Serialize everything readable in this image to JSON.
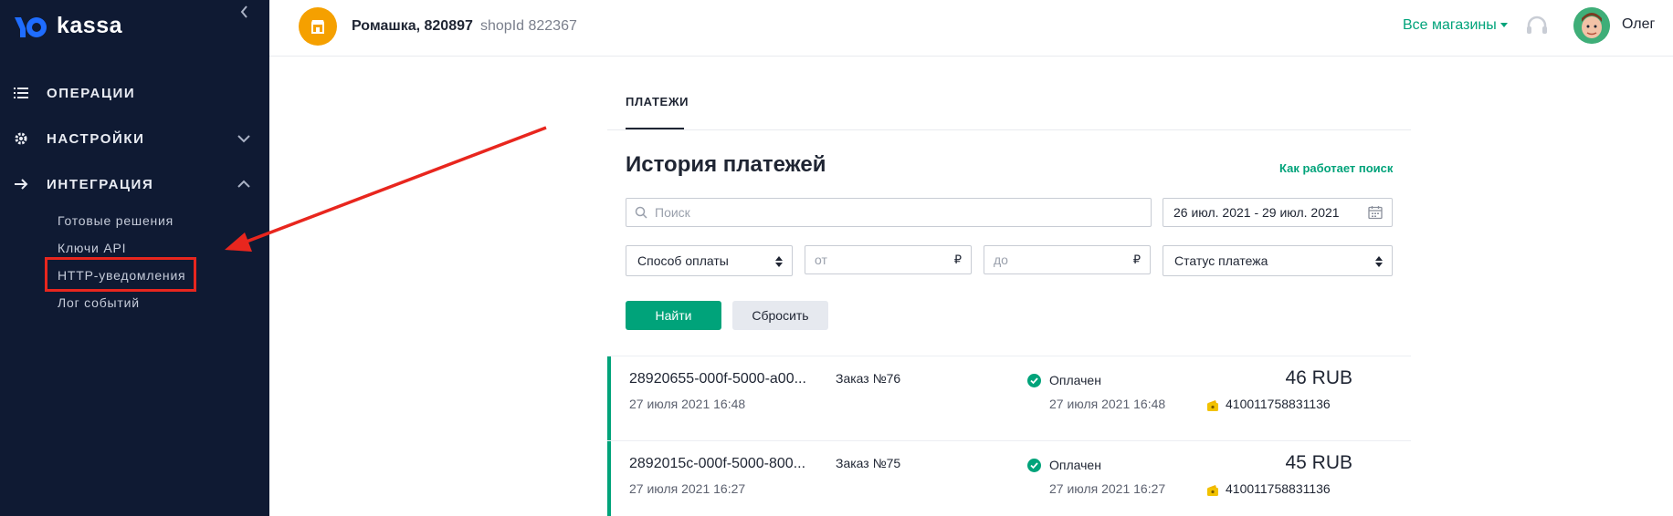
{
  "brand": {
    "name": "kassa"
  },
  "sidebar": {
    "sections": [
      {
        "label": "ОПЕРАЦИИ",
        "icon": "list-icon"
      },
      {
        "label": "НАСТРОЙКИ",
        "icon": "gear-icon",
        "chevron": "chevron-down-icon"
      },
      {
        "label": "ИНТЕГРАЦИЯ",
        "icon": "arrow-right-icon",
        "chevron": "chevron-up-icon"
      }
    ],
    "sub_items": [
      "Готовые решения",
      "Ключи API",
      "HTTP-уведомления",
      "Лог событий"
    ]
  },
  "header": {
    "shop_name": "Ромашка, 820897",
    "shop_id": "shopId 822367",
    "stores_dropdown": "Все магазины",
    "user_name": "Олег"
  },
  "tabs": [
    "ПЛАТЕЖИ"
  ],
  "main": {
    "title": "История платежей",
    "how_link": "Как работает поиск",
    "search_placeholder": "Поиск",
    "date_range": "26 июл. 2021 - 29 июл. 2021",
    "payment_method": "Способ оплаты",
    "amount_from_placeholder": "от",
    "amount_to_placeholder": "до",
    "currency_symbol": "₽",
    "status_select": "Статус платежа",
    "find_button": "Найти",
    "reset_button": "Сбросить"
  },
  "payments": [
    {
      "id": "28920655-000f-5000-a00...",
      "date": "27 июля 2021 16:48",
      "order": "Заказ №76",
      "status": "Оплачен",
      "status_date": "27 июля 2021 16:48",
      "amount": "46 RUB",
      "wallet": "410011758831136"
    },
    {
      "id": "2892015c-000f-5000-800...",
      "date": "27 июля 2021 16:27",
      "order": "Заказ №75",
      "status": "Оплачен",
      "status_date": "27 июля 2021 16:27",
      "amount": "45 RUB",
      "wallet": "410011758831136"
    }
  ],
  "colors": {
    "sidebar_bg": "#0f1a33",
    "accent": "#00a37a",
    "shop_avatar": "#f5a000",
    "annotation": "#e8261e"
  }
}
